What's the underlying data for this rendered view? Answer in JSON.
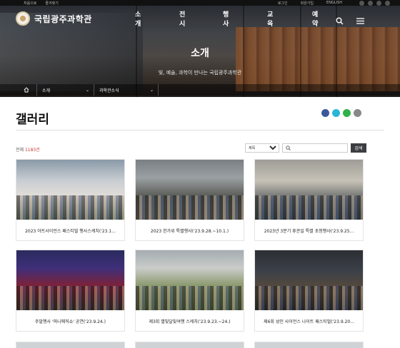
{
  "topbar": {
    "left_links": [
      "처음으로",
      "즐겨찾기"
    ],
    "right_links": [
      "로그인",
      "회원가입",
      "ENGLISH"
    ],
    "sns": [
      "facebook-icon",
      "instagram-icon",
      "youtube-icon",
      "blog-icon"
    ]
  },
  "header": {
    "logo_text": "국립광주과학관",
    "nav": [
      "소개",
      "전시",
      "행사",
      "교육",
      "예약"
    ]
  },
  "hero": {
    "title": "소개",
    "subtitle": "빛, 예술, 과학이 만나는 국립광주과학관"
  },
  "breadcrumb": {
    "level1": "소개",
    "level2": "과학관소식"
  },
  "page": {
    "title": "갤러리",
    "total_label": "전체",
    "total_count": "1183건"
  },
  "search": {
    "select_value": "제목",
    "input_value": "",
    "button_label": "검색"
  },
  "gallery": [
    {
      "caption": "2023 아트사이언스 페스티벌 행사스케치('23.1..."
    },
    {
      "caption": "2023 한가위 특별행사('23.9.28.~10.1.)"
    },
    {
      "caption": "2023년 3분기 휴관일 특별 초청행사('23.9.25..."
    },
    {
      "caption": "주말행사 '퍼니매직쇼' 공연('23.9.24.)"
    },
    {
      "caption": "제3회 별빛달빛여행 스케치('23.9.23.~24.)"
    },
    {
      "caption": "제6회 성인 사이언스 나이트 페스티벌('23.9.20..."
    }
  ]
}
